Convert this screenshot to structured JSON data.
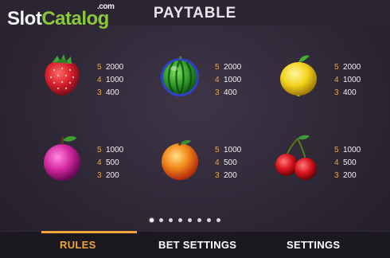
{
  "header": {
    "logo_slot": "Slot",
    "logo_catalog": "Catalog",
    "logo_com": ".com",
    "title": "PAYTABLE"
  },
  "symbols": [
    {
      "icon": "strawberry-icon",
      "pays": [
        {
          "count": "5",
          "value": "2000"
        },
        {
          "count": "4",
          "value": "1000"
        },
        {
          "count": "3",
          "value": "400"
        }
      ]
    },
    {
      "icon": "watermelon-icon",
      "pays": [
        {
          "count": "5",
          "value": "2000"
        },
        {
          "count": "4",
          "value": "1000"
        },
        {
          "count": "3",
          "value": "400"
        }
      ]
    },
    {
      "icon": "lemon-icon",
      "pays": [
        {
          "count": "5",
          "value": "2000"
        },
        {
          "count": "4",
          "value": "1000"
        },
        {
          "count": "3",
          "value": "400"
        }
      ]
    },
    {
      "icon": "plum-icon",
      "pays": [
        {
          "count": "5",
          "value": "1000"
        },
        {
          "count": "4",
          "value": "500"
        },
        {
          "count": "3",
          "value": "200"
        }
      ]
    },
    {
      "icon": "orange-icon",
      "pays": [
        {
          "count": "5",
          "value": "1000"
        },
        {
          "count": "4",
          "value": "500"
        },
        {
          "count": "3",
          "value": "200"
        }
      ]
    },
    {
      "icon": "cherries-icon",
      "pays": [
        {
          "count": "5",
          "value": "1000"
        },
        {
          "count": "4",
          "value": "500"
        },
        {
          "count": "3",
          "value": "200"
        }
      ]
    }
  ],
  "pagination": {
    "pages": 8,
    "current": 1
  },
  "tabs": [
    {
      "label": "RULES",
      "active": true
    },
    {
      "label": "BET SETTINGS",
      "active": false
    },
    {
      "label": "SETTINGS",
      "active": false
    }
  ],
  "colors": {
    "accent": "#f0a53a",
    "brand_green": "#8cc63f",
    "background": "#2e2836"
  }
}
